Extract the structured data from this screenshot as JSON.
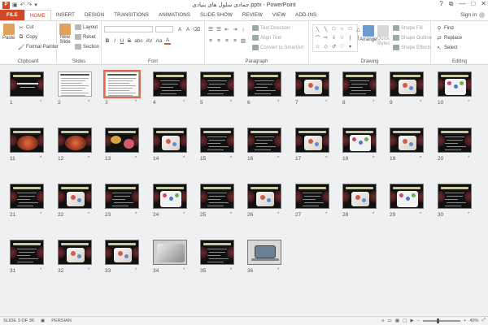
{
  "window": {
    "title": "جمادی سلول های بنیادی.pptx - PowerPoint",
    "controls": {
      "help": "?",
      "restore": "⧉",
      "minimize": "—",
      "maximize": "□",
      "close": "✕"
    }
  },
  "qat": {
    "save": "▣",
    "undo": "↶",
    "redo": "↷",
    "customize": "▾"
  },
  "tabs": [
    {
      "label": "FILE"
    },
    {
      "label": "HOME"
    },
    {
      "label": "INSERT"
    },
    {
      "label": "DESIGN"
    },
    {
      "label": "TRANSITIONS"
    },
    {
      "label": "ANIMATIONS"
    },
    {
      "label": "SLIDE SHOW"
    },
    {
      "label": "REVIEW"
    },
    {
      "label": "VIEW"
    },
    {
      "label": "ADD-INS"
    }
  ],
  "signin": "Sign in",
  "ribbon": {
    "clipboard": {
      "paste": "Paste",
      "cut": "Cut",
      "copy": "Copy",
      "format_painter": "Format Painter",
      "label": "Clipboard"
    },
    "slides": {
      "new_slide": "New",
      "new_slide2": "Slide",
      "layout": "Layout",
      "reset": "Reset",
      "section": "Section",
      "label": "Slides"
    },
    "font": {
      "label": "Font",
      "bold": "B",
      "italic": "I",
      "underline": "U",
      "strike": "S",
      "shadow": "abc",
      "spacing": "AV",
      "case": "Aa",
      "color": "A"
    },
    "paragraph": {
      "text_direction": "Text Direction",
      "align_text": "Align Text",
      "convert": "Convert to SmartArt",
      "label": "Paragraph"
    },
    "drawing": {
      "arrange": "Arrange",
      "quick_styles": "Quick",
      "quick_styles2": "Styles",
      "shape_fill": "Shape Fill",
      "shape_outline": "Shape Outline",
      "shape_effects": "Shape Effects",
      "label": "Drawing"
    },
    "editing": {
      "find": "Find",
      "replace": "Replace",
      "select": "Select",
      "label": "Editing"
    }
  },
  "slides": [
    {
      "n": "1"
    },
    {
      "n": "2"
    },
    {
      "n": "3"
    },
    {
      "n": "4"
    },
    {
      "n": "5"
    },
    {
      "n": "6"
    },
    {
      "n": "7"
    },
    {
      "n": "8"
    },
    {
      "n": "9"
    },
    {
      "n": "10"
    },
    {
      "n": "11"
    },
    {
      "n": "12"
    },
    {
      "n": "13"
    },
    {
      "n": "14"
    },
    {
      "n": "15"
    },
    {
      "n": "16"
    },
    {
      "n": "17"
    },
    {
      "n": "18"
    },
    {
      "n": "19"
    },
    {
      "n": "20"
    },
    {
      "n": "21"
    },
    {
      "n": "22"
    },
    {
      "n": "23"
    },
    {
      "n": "24"
    },
    {
      "n": "25"
    },
    {
      "n": "26"
    },
    {
      "n": "27"
    },
    {
      "n": "28"
    },
    {
      "n": "29"
    },
    {
      "n": "30"
    },
    {
      "n": "31"
    },
    {
      "n": "32"
    },
    {
      "n": "33"
    },
    {
      "n": "34"
    },
    {
      "n": "35"
    },
    {
      "n": "36"
    }
  ],
  "slide_star": "*",
  "status": {
    "slide_info": "SLIDE 3 OF 36",
    "language": "PERSIAN",
    "zoom": "40%",
    "zoom_fraction": 0.4
  },
  "colors": {
    "accent": "#d24726",
    "selection": "#e5694a"
  }
}
